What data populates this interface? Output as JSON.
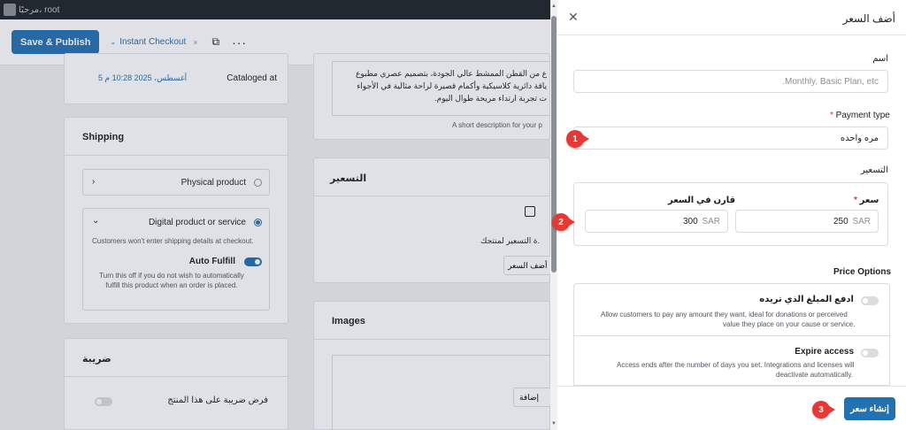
{
  "adminbar": {
    "greeting": "مرحبًا، root"
  },
  "toolbar": {
    "save_label": "Save & Publish",
    "template_label": "Instant Checkout"
  },
  "catalog": {
    "label": "Cataloged at",
    "value": "5 أغسطس، 2025 10:28 م"
  },
  "description": {
    "lines": [
      "ع من القطن الممشط عالي الجودة، بتصميم عصري مطبوع",
      "ياقة دائرية كلاسيكية وأكمام قصيرة لراحة مثالية في الأجواء",
      "ت تجربة ارتداء مريحة طوال اليوم."
    ],
    "hint": "A short description for your p"
  },
  "shipping": {
    "title": "Shipping",
    "physical_label": "Physical product",
    "digital_label": "Digital product or service",
    "digital_hint": "Customers won't enter shipping details at checkout.",
    "auto_fulfill_label": "Auto Fulfill",
    "auto_fulfill_help": "Turn this off if you do not wish to automatically fulfill this product when an order is placed."
  },
  "pricing_card": {
    "title": "التسعير",
    "text": "ة التسعير لمنتجك.",
    "button": "أضف السعر"
  },
  "images_card": {
    "title": "Images",
    "button": "إضافة"
  },
  "tax_card": {
    "title": "ضريبة",
    "toggle_label": "فرض ضريبة على هذا المنتج"
  },
  "drawer": {
    "title": "أضف السعر",
    "name_label": "اسم",
    "name_placeholder": "Monthly, Basic Plan, etc.",
    "payment_type_label": "Payment type",
    "payment_type_value": "مره واحده",
    "pricing_label": "التسعير",
    "price_label": "سعر",
    "price_value": "250",
    "compare_label": "قارن في السعر",
    "compare_value": "300",
    "currency": "SAR",
    "options_title": "Price Options",
    "options": [
      {
        "label": "ادفع المبلغ الذي تريده",
        "help_line1": "Allow customers to pay any amount they want, ideal for donations or perceived",
        "help_line2": "value they place on your cause or service."
      },
      {
        "label": "Expire access",
        "help_line1": "Access ends after the number of days you set. Integrations and licenses will",
        "help_line2": "deactivate automatically."
      }
    ],
    "create_button": "إنشاء سعر"
  },
  "markers": [
    "1",
    "2",
    "3"
  ],
  "colors": {
    "primary": "#2271b1",
    "marker": "#e53935",
    "adminbar": "#1d2327"
  }
}
